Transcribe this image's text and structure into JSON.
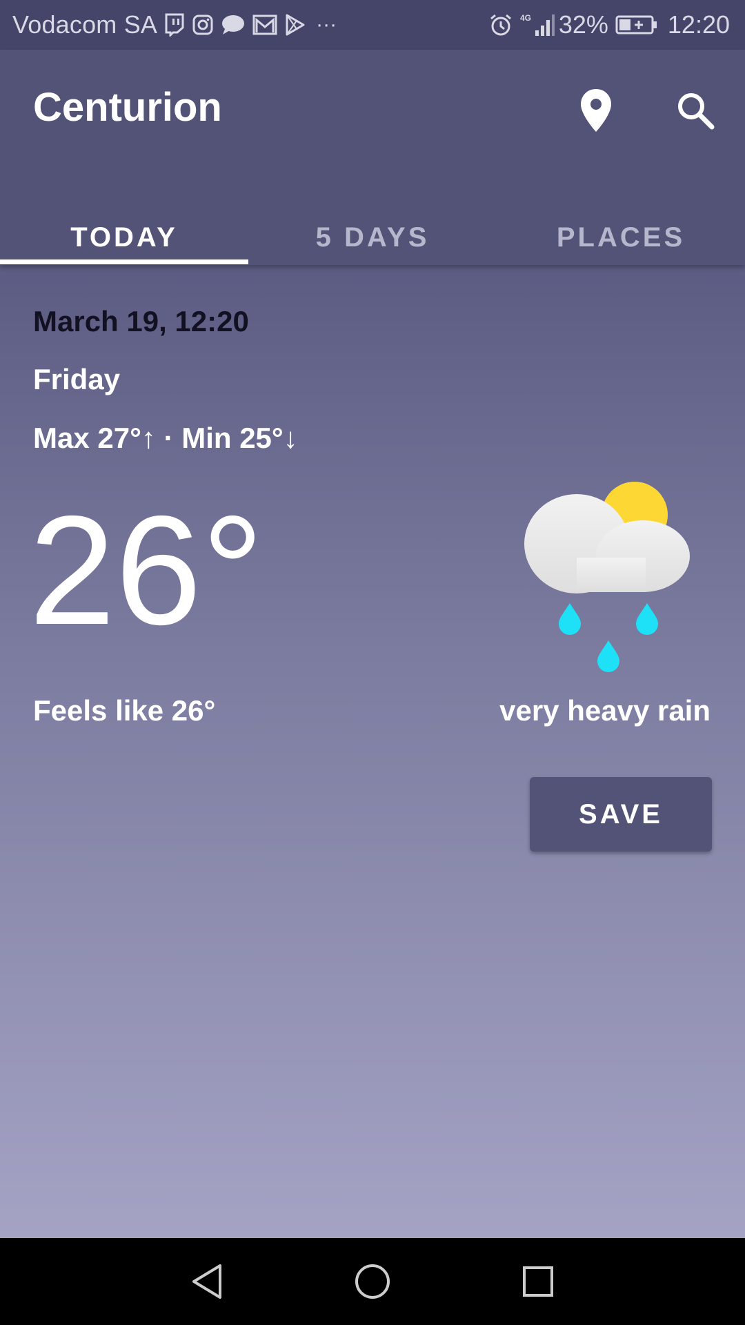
{
  "status_bar": {
    "carrier": "Vodacom SA",
    "notification_icons": [
      "twitch-icon",
      "instagram-icon",
      "chat-bubble-icon",
      "gmail-icon",
      "play-store-icon",
      "more-dots-icon"
    ],
    "more_glyph": "···",
    "network": "4G",
    "battery_percent": "32%",
    "time": "12:20"
  },
  "toolbar": {
    "title": "Centurion",
    "location_icon": "location-pin-icon",
    "search_icon": "search-icon"
  },
  "tabs": [
    {
      "label": "TODAY",
      "active": true
    },
    {
      "label": "5 DAYS",
      "active": false
    },
    {
      "label": "PLACES",
      "active": false
    }
  ],
  "today": {
    "datetime": "March 19, 12:20",
    "day": "Friday",
    "min_max": "Max 27°↑ · Min 25°↓",
    "temperature": "26°",
    "feels_like": "Feels like 26°",
    "condition": "very heavy rain",
    "condition_icon": "rain-sun-cloud-icon",
    "save_label": "SAVE"
  },
  "colors": {
    "status_bar": "#454469",
    "app_bar": "#535377",
    "gradient_top": "#5c5b82",
    "gradient_bottom": "#a4a3c4",
    "sun": "#fdd835",
    "rain_drop": "#1ee0f7",
    "cloud": "#eeeeee"
  },
  "nav_bar": {
    "buttons": [
      "back-icon",
      "home-icon",
      "recent-apps-icon"
    ]
  }
}
